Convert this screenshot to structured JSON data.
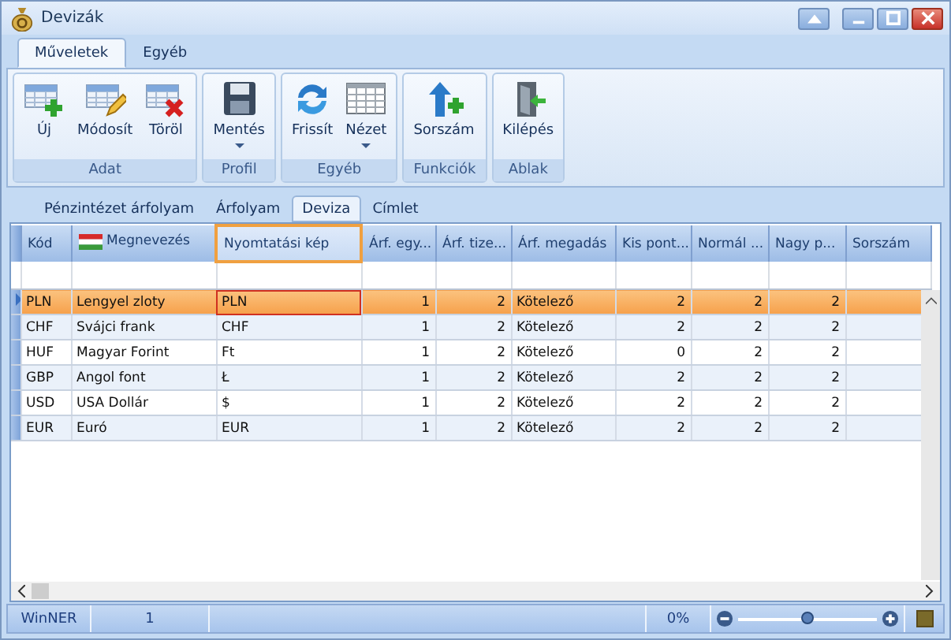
{
  "window": {
    "title": "Devizák"
  },
  "ribbon": {
    "tabs": [
      {
        "label": "Műveletek",
        "selected": true
      },
      {
        "label": "Egyéb",
        "selected": false
      }
    ],
    "groups": [
      {
        "label": "Adat",
        "buttons": [
          {
            "label": "Új",
            "dropdown": false
          },
          {
            "label": "Módosít",
            "dropdown": false
          },
          {
            "label": "Töröl",
            "dropdown": false
          }
        ]
      },
      {
        "label": "Profil",
        "buttons": [
          {
            "label": "Mentés",
            "dropdown": true
          }
        ]
      },
      {
        "label": "Egyéb",
        "buttons": [
          {
            "label": "Frissít",
            "dropdown": false
          },
          {
            "label": "Nézet",
            "dropdown": true
          }
        ]
      },
      {
        "label": "Funkciók",
        "buttons": [
          {
            "label": "Sorszám",
            "dropdown": false
          }
        ]
      },
      {
        "label": "Ablak",
        "buttons": [
          {
            "label": "Kilépés",
            "dropdown": false
          }
        ]
      }
    ]
  },
  "view_tabs": [
    {
      "label": "Pénzintézet árfolyam",
      "selected": false
    },
    {
      "label": "Árfolyam",
      "selected": false
    },
    {
      "label": "Deviza",
      "selected": true
    },
    {
      "label": "Címlet",
      "selected": false
    }
  ],
  "grid": {
    "columns": [
      {
        "label": "Kód",
        "kind": "text",
        "selected": false
      },
      {
        "label": "Megnevezés",
        "kind": "text",
        "selected": false
      },
      {
        "label": "Nyomtatási kép",
        "kind": "text",
        "selected": true
      },
      {
        "label": "Árf. egy...",
        "kind": "number",
        "selected": false
      },
      {
        "label": "Árf. tize...",
        "kind": "number",
        "selected": false
      },
      {
        "label": "Árf. megadás",
        "kind": "text",
        "selected": false
      },
      {
        "label": "Kis pont...",
        "kind": "number",
        "selected": false
      },
      {
        "label": "Normál ...",
        "kind": "number",
        "selected": false
      },
      {
        "label": "Nagy p...",
        "kind": "number",
        "selected": false
      },
      {
        "label": "Sorszám",
        "kind": "text",
        "selected": false
      }
    ],
    "rows": [
      {
        "selected": true,
        "cells": [
          "PLN",
          "Lengyel zloty",
          "PLN",
          "1",
          "2",
          "Kötelező",
          "2",
          "2",
          "2",
          ""
        ]
      },
      {
        "selected": false,
        "cells": [
          "CHF",
          "Svájci frank",
          "CHF",
          "1",
          "2",
          "Kötelező",
          "2",
          "2",
          "2",
          ""
        ]
      },
      {
        "selected": false,
        "cells": [
          "HUF",
          "Magyar Forint",
          "Ft",
          "1",
          "2",
          "Kötelező",
          "0",
          "2",
          "2",
          ""
        ]
      },
      {
        "selected": false,
        "cells": [
          "GBP",
          "Angol font",
          "Ł",
          "1",
          "2",
          "Kötelező",
          "2",
          "2",
          "2",
          ""
        ]
      },
      {
        "selected": false,
        "cells": [
          "USD",
          "USA Dollár",
          "$",
          "1",
          "2",
          "Kötelező",
          "2",
          "2",
          "2",
          ""
        ]
      },
      {
        "selected": false,
        "cells": [
          "EUR",
          "Euró",
          "EUR",
          "1",
          "2",
          "Kötelező",
          "2",
          "2",
          "2",
          ""
        ]
      }
    ]
  },
  "status_bar": {
    "app": "WinNER",
    "count": "1",
    "zoom_reading": "0%",
    "zoom": {
      "level": 0.5
    }
  }
}
